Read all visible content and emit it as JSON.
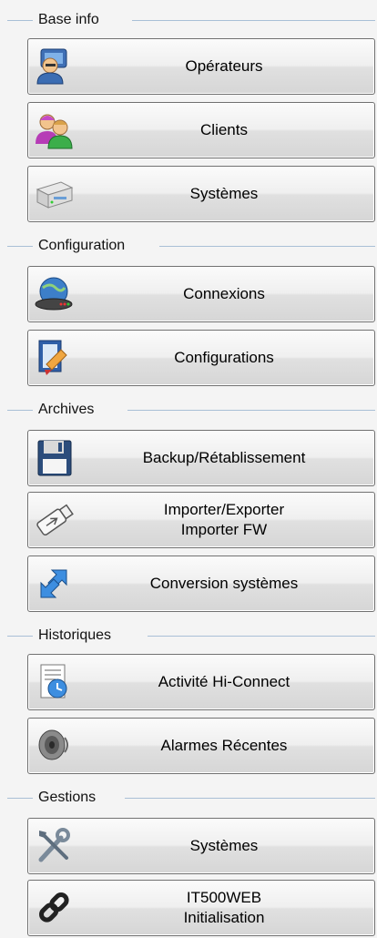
{
  "groups": [
    {
      "title": "Base info",
      "buttons": [
        {
          "label": "Opérateurs",
          "icon": "operator-icon"
        },
        {
          "label": "Clients",
          "icon": "clients-icon"
        },
        {
          "label": "Systèmes",
          "icon": "system-device-icon"
        }
      ]
    },
    {
      "title": "Configuration",
      "buttons": [
        {
          "label": "Connexions",
          "icon": "connection-globe-icon"
        },
        {
          "label": "Configurations",
          "icon": "configuration-icon"
        }
      ]
    },
    {
      "title": "Archives",
      "buttons": [
        {
          "label": "Backup/Rétablissement",
          "icon": "floppy-disk-icon"
        },
        {
          "label": "Importer/Exporter",
          "label2": "Importer FW",
          "icon": "usb-drive-icon"
        },
        {
          "label": "Conversion systèmes",
          "icon": "conversion-arrows-icon"
        }
      ]
    },
    {
      "title": "Historiques",
      "buttons": [
        {
          "label": "Activité Hi-Connect",
          "icon": "activity-log-icon"
        },
        {
          "label": "Alarmes Récentes",
          "icon": "speaker-alarm-icon"
        }
      ]
    },
    {
      "title": "Gestions",
      "buttons": [
        {
          "label": "Systèmes",
          "icon": "tools-icon"
        },
        {
          "label": "IT500WEB",
          "label2": "Initialisation",
          "icon": "chain-link-icon"
        }
      ]
    }
  ]
}
